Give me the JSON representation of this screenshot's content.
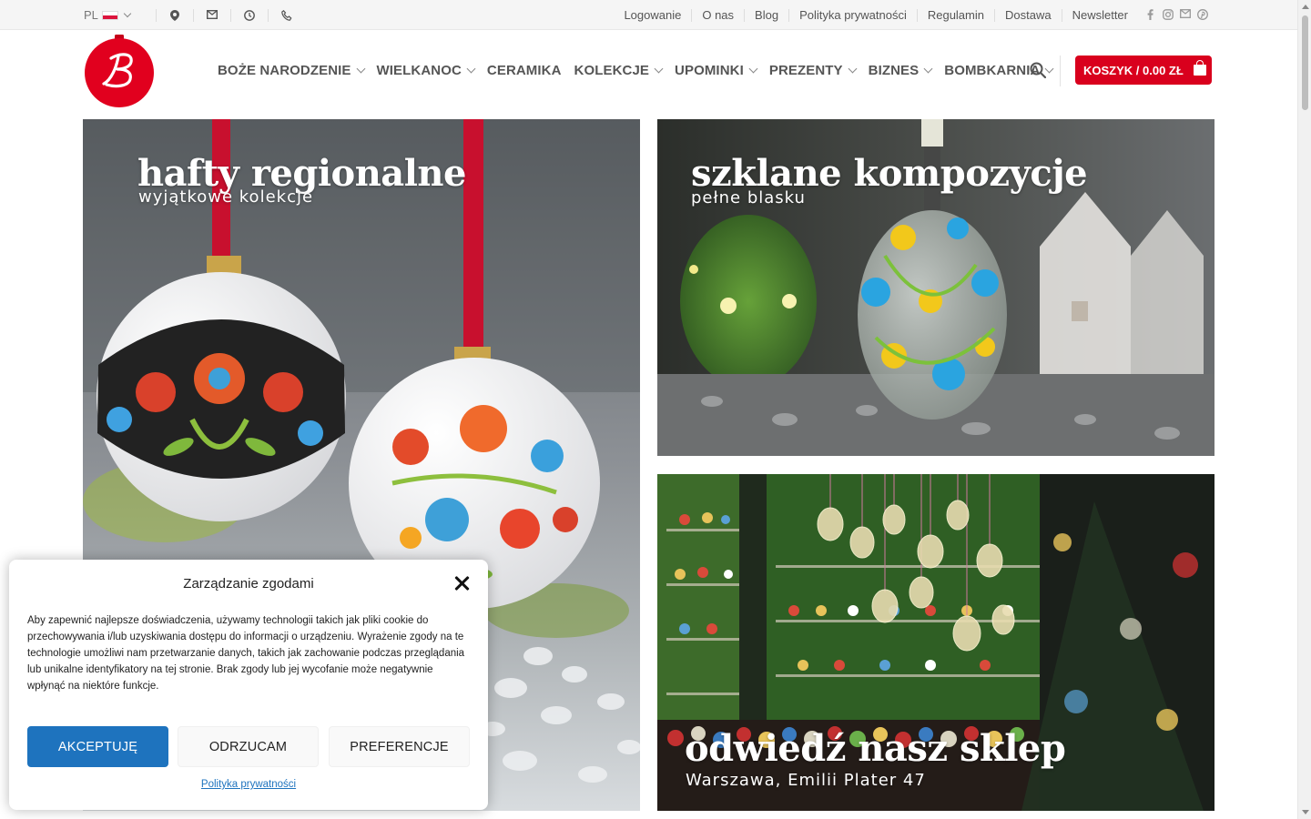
{
  "topbar": {
    "language": "PL",
    "icons": [
      "map-pin-icon",
      "envelope-icon",
      "clock-icon",
      "phone-icon"
    ],
    "links": [
      "Logowanie",
      "O nas",
      "Blog",
      "Polityka prywatności",
      "Regulamin",
      "Dostawa",
      "Newsletter"
    ],
    "social": [
      "facebook-icon",
      "instagram-icon",
      "envelope-icon",
      "pinterest-icon"
    ]
  },
  "header": {
    "logo_letter": "B",
    "nav": [
      {
        "label": "BOŻE NARODZENIE",
        "dropdown": true
      },
      {
        "label": "WIELKANOC",
        "dropdown": true
      },
      {
        "label": "CERAMIKA",
        "dropdown": false
      },
      {
        "label": "KOLEKCJE",
        "dropdown": true
      },
      {
        "label": "UPOMINKI",
        "dropdown": true
      },
      {
        "label": "PREZENTY",
        "dropdown": true
      },
      {
        "label": "BIZNES",
        "dropdown": true
      },
      {
        "label": "BOMBKARNIA",
        "dropdown": true
      }
    ],
    "cart_label": "KOSZYK / 0.00 ZŁ"
  },
  "banners": {
    "left": {
      "title": "hafty regionalne",
      "subtitle": "wyjątkowe kolekcje"
    },
    "top_right": {
      "title": "szklane kompozycje",
      "subtitle": "pełne blasku"
    },
    "bottom_right": {
      "title": "odwiedź nasz sklep",
      "subtitle": "Warszawa, Emilii Plater 47"
    }
  },
  "consent": {
    "title": "Zarządzanie zgodami",
    "text": "Aby zapewnić najlepsze doświadczenia, używamy technologii takich jak pliki cookie do przechowywania i/lub uzyskiwania dostępu do informacji o urządzeniu. Wyrażenie zgody na te technologie umożliwi nam przetwarzanie danych, takich jak zachowanie podczas przeglądania lub unikalne identyfikatory na tej stronie. Brak zgody lub jej wycofanie może negatywnie wpłynąć na niektóre funkcje.",
    "accept": "AKCEPTUJĘ",
    "deny": "ODRZUCAM",
    "preferences": "PREFERENCJE",
    "privacy_link": "Polityka prywatności"
  },
  "colors": {
    "brand_red": "#d9001d",
    "accept_blue": "#1e73be",
    "topbar_bg": "#f5f5f5"
  }
}
